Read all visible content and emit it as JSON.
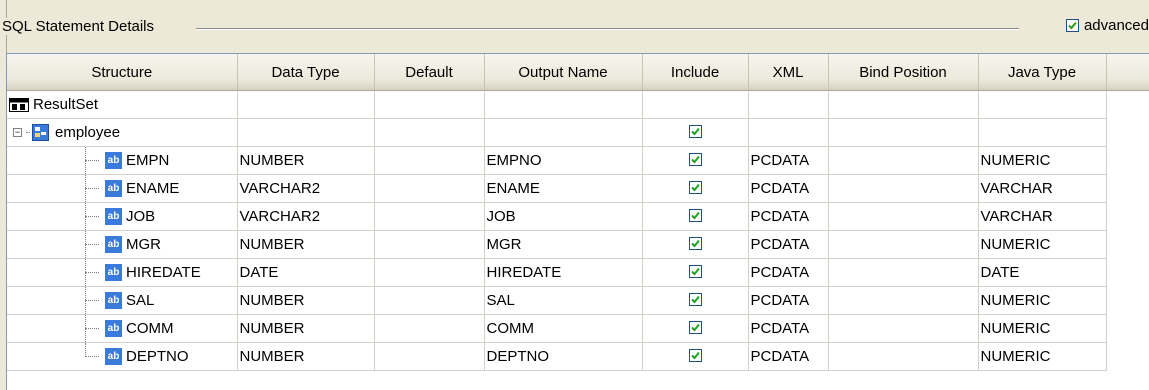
{
  "section": {
    "title": "SQL Statement Details",
    "advanced_label": "advanced",
    "advanced_checked": true
  },
  "columns": [
    "Structure",
    "Data Type",
    "Default",
    "Output Name",
    "Include",
    "XML",
    "Bind Position",
    "Java Type"
  ],
  "root": {
    "label": "ResultSet",
    "icon": "resultset-icon"
  },
  "entity": {
    "label": "employee",
    "icon": "entity-icon",
    "include": true,
    "expanded": true
  },
  "rows": [
    {
      "structure": "EMPN",
      "data_type": "NUMBER",
      "default": "",
      "output_name": "EMPNO",
      "include": true,
      "xml": "PCDATA",
      "bind_position": "",
      "java_type": "NUMERIC"
    },
    {
      "structure": "ENAME",
      "data_type": "VARCHAR2",
      "default": "",
      "output_name": "ENAME",
      "include": true,
      "xml": "PCDATA",
      "bind_position": "",
      "java_type": "VARCHAR"
    },
    {
      "structure": "JOB",
      "data_type": "VARCHAR2",
      "default": "",
      "output_name": "JOB",
      "include": true,
      "xml": "PCDATA",
      "bind_position": "",
      "java_type": "VARCHAR"
    },
    {
      "structure": "MGR",
      "data_type": "NUMBER",
      "default": "",
      "output_name": "MGR",
      "include": true,
      "xml": "PCDATA",
      "bind_position": "",
      "java_type": "NUMERIC"
    },
    {
      "structure": "HIREDATE",
      "data_type": "DATE",
      "default": "",
      "output_name": "HIREDATE",
      "include": true,
      "xml": "PCDATA",
      "bind_position": "",
      "java_type": "DATE"
    },
    {
      "structure": "SAL",
      "data_type": "NUMBER",
      "default": "",
      "output_name": "SAL",
      "include": true,
      "xml": "PCDATA",
      "bind_position": "",
      "java_type": "NUMERIC"
    },
    {
      "structure": "COMM",
      "data_type": "NUMBER",
      "default": "",
      "output_name": "COMM",
      "include": true,
      "xml": "PCDATA",
      "bind_position": "",
      "java_type": "NUMERIC"
    },
    {
      "structure": "DEPTNO",
      "data_type": "NUMBER",
      "default": "",
      "output_name": "DEPTNO",
      "include": true,
      "xml": "PCDATA",
      "bind_position": "",
      "java_type": "NUMERIC"
    }
  ],
  "field_icon_text": "ab",
  "colors": {
    "header_bg": "#ebeadb",
    "field_icon": "#3a7ad8",
    "check": "#21a121"
  }
}
